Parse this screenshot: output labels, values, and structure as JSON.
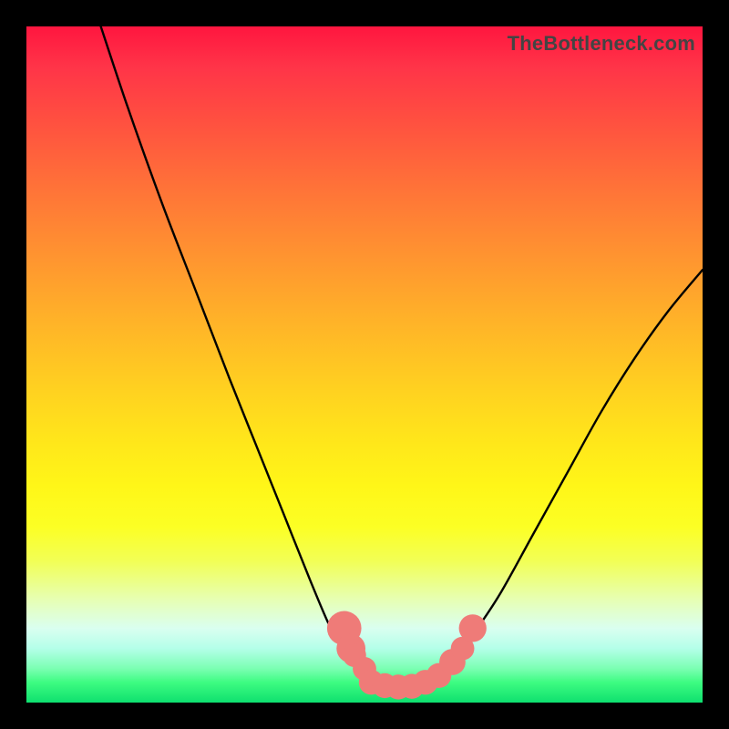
{
  "attribution": "TheBottleneck.com",
  "chart_data": {
    "type": "line",
    "title": "",
    "xlabel": "",
    "ylabel": "",
    "xlim": [
      0,
      100
    ],
    "ylim": [
      0,
      100
    ],
    "series": [
      {
        "name": "left-curve",
        "x": [
          11,
          15,
          20,
          25,
          30,
          34,
          38,
          42,
          45,
          47,
          49,
          51
        ],
        "values": [
          100,
          88,
          74,
          61,
          48,
          38,
          28,
          18,
          11,
          8,
          5,
          3
        ]
      },
      {
        "name": "right-curve",
        "x": [
          61,
          63,
          66,
          70,
          75,
          80,
          85,
          90,
          95,
          100
        ],
        "values": [
          4,
          6,
          10,
          16,
          25,
          34,
          43,
          51,
          58,
          64
        ]
      }
    ],
    "markers": [
      {
        "name": "left-cluster-top",
        "x": 47,
        "y": 11,
        "r": 2.0
      },
      {
        "name": "left-cluster-mid",
        "x": 48,
        "y": 8,
        "r": 1.6
      },
      {
        "name": "left-cluster-bot",
        "x": 48.5,
        "y": 7,
        "r": 1.2
      },
      {
        "name": "left-dot-low",
        "x": 50,
        "y": 5,
        "r": 1.2
      },
      {
        "name": "bottom-dot-1",
        "x": 51,
        "y": 3,
        "r": 1.3
      },
      {
        "name": "bottom-dot-2",
        "x": 53,
        "y": 2.5,
        "r": 1.3
      },
      {
        "name": "bottom-dot-3",
        "x": 55,
        "y": 2.3,
        "r": 1.3
      },
      {
        "name": "bottom-dot-4",
        "x": 57,
        "y": 2.4,
        "r": 1.3
      },
      {
        "name": "bottom-dot-5",
        "x": 59,
        "y": 3,
        "r": 1.3
      },
      {
        "name": "right-dot-1",
        "x": 61,
        "y": 4,
        "r": 1.3
      },
      {
        "name": "right-dot-2",
        "x": 63,
        "y": 6,
        "r": 1.4
      },
      {
        "name": "right-dot-3",
        "x": 64.5,
        "y": 8,
        "r": 1.2
      },
      {
        "name": "right-cluster-top",
        "x": 66,
        "y": 11,
        "r": 1.5
      }
    ],
    "marker_color": "#ef7b78",
    "curve_color": "#000000"
  }
}
